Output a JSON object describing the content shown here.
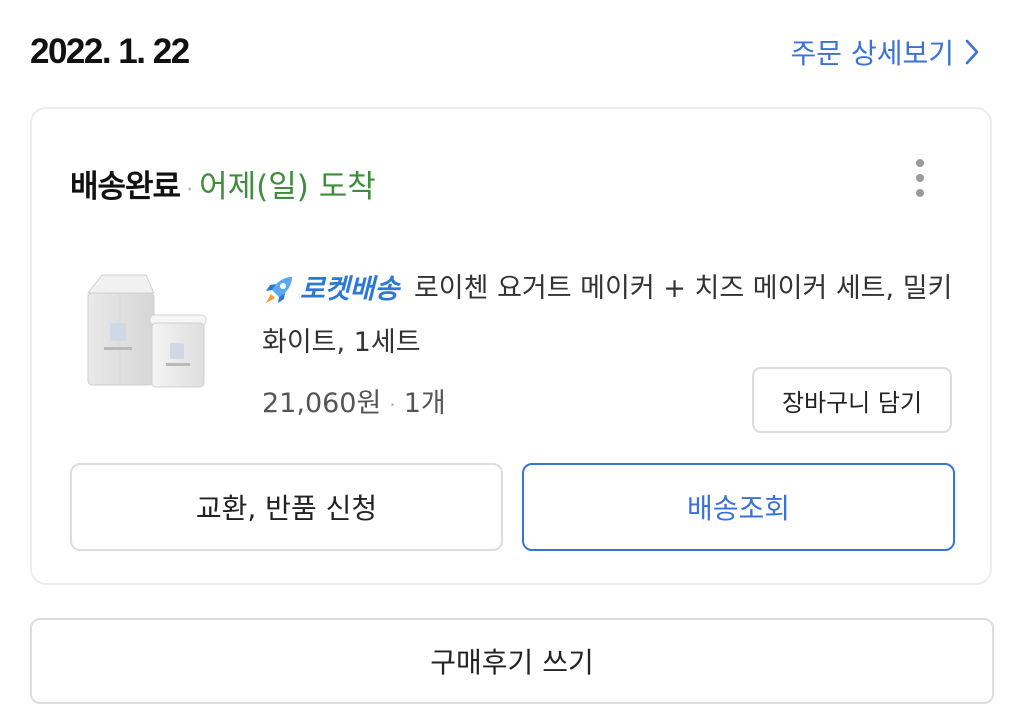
{
  "order": {
    "date": "2022. 1. 22",
    "detail_link_label": "주문 상세보기"
  },
  "shipment": {
    "status": "배송완료",
    "separator": "·",
    "arrival": "어제(일) 도착"
  },
  "product": {
    "badge_label": "로켓배송",
    "title": "로이첸 요거트 메이커 + 치즈 메이커 세트, 밀키화이트, 1세트",
    "price": "21,060원",
    "separator": "·",
    "quantity": "1개",
    "image_icon": "product-thumbnail",
    "badge_icon": "rocket-icon"
  },
  "actions": {
    "add_to_cart": "장바구니 담기",
    "exchange_return": "교환, 반품 신청",
    "track_delivery": "배송조회",
    "write_review": "구매후기 쓰기"
  },
  "colors": {
    "link_blue": "#3b72d9",
    "status_green": "#3d8d3a",
    "rocket_blue": "#2b78d6"
  }
}
